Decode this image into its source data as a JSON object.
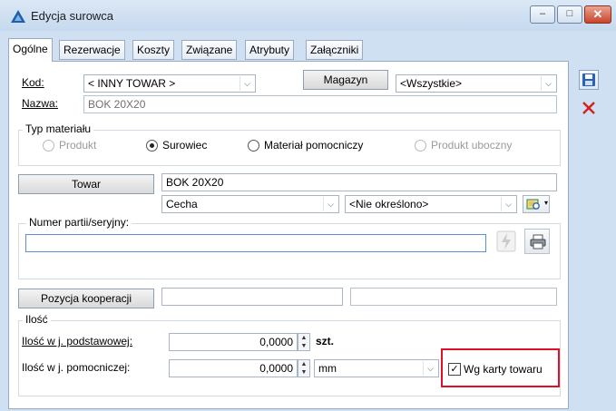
{
  "window": {
    "title": "Edycja surowca"
  },
  "tabs": [
    "Ogólne",
    "Rezerwacje",
    "Koszty",
    "Związane",
    "Atrybuty",
    "Załączniki"
  ],
  "form": {
    "kod_label": "Kod:",
    "kod_value": "< INNY TOWAR >",
    "nazwa_label": "Nazwa:",
    "nazwa_value": "BOK 20X20",
    "magazyn_button": "Magazyn",
    "magazyn_value": "<Wszystkie>"
  },
  "typ_materialu": {
    "title": "Typ materiału",
    "options": [
      "Produkt",
      "Surowiec",
      "Materiał pomocniczy",
      "Produkt uboczny"
    ],
    "selected": "Surowiec"
  },
  "towar": {
    "button": "Towar",
    "value": "BOK 20X20",
    "cecha_value": "Cecha",
    "cecha_select": "<Nie określono>"
  },
  "partia": {
    "label": "Numer partii/seryjny:",
    "value": ""
  },
  "kooperacja": {
    "button": "Pozycja kooperacji",
    "value1": "",
    "value2": ""
  },
  "ilosc": {
    "title": "Ilość",
    "podst_label": "Ilość w j. podstawowej:",
    "podst_value": "0,0000",
    "podst_unit": "szt.",
    "pomoc_label": "Ilość w j. pomocniczej:",
    "pomoc_value": "0,0000",
    "pomoc_unit": "mm",
    "wg_karty_label": "Wg karty towaru",
    "wg_karty_checked": true
  },
  "colors": {
    "accent": "#1f5fa8",
    "highlight": "#e0102a",
    "save": "#2a62b8",
    "cancel": "#d42020"
  }
}
